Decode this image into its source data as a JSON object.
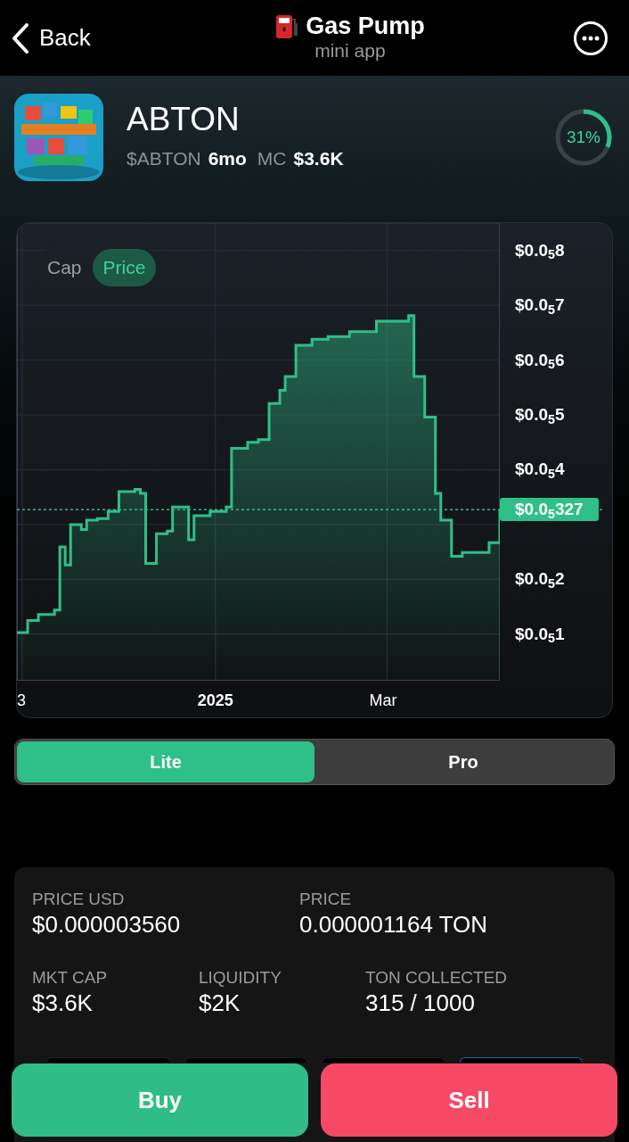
{
  "header": {
    "back": "Back",
    "title": "Gas Pump",
    "subtitle": "mini app"
  },
  "token": {
    "name": "ABTON",
    "ticker": "$ABTON",
    "age": "6mo",
    "mc_label": "MC",
    "mc_value": "$3.6K",
    "progress": {
      "level": 0.31,
      "label": "31%"
    }
  },
  "chart_toggle": [
    {
      "label": "Cap",
      "selected": false
    },
    {
      "label": "Price",
      "selected": true
    }
  ],
  "chart": {
    "current_price": "$0.0$_{5}$327",
    "y_labels": [
      "$0.0$_{5}$8",
      "$0.0$_{5}$7",
      "$0.0$_{5}$6",
      "$0.0$_{5}$5",
      "$0.0$_{5}$4",
      "$0.0$_{5}$2",
      "$0.0$_{5}$1"
    ],
    "x_labels": [
      "3",
      "2025",
      "Mar"
    ]
  },
  "mode_tabs": [
    {
      "label": "Lite",
      "selected": true
    },
    {
      "label": "Pro",
      "selected": false
    }
  ],
  "stats": [
    {
      "label": "PRICE USD",
      "value": "$0.000003560"
    },
    {
      "label": "PRICE",
      "value": "0.000001164 TON"
    },
    {
      "label": "MKT CAP",
      "value": "$3.6K"
    },
    {
      "label": "LIQUIDITY",
      "value": "$2K"
    },
    {
      "label": "TON COLLECTED",
      "value": "315 / 1000"
    }
  ],
  "chips": [
    {
      "selected": false
    },
    {
      "selected": false
    },
    {
      "selected": false
    },
    {
      "selected": true
    }
  ],
  "actions": [
    {
      "kind": "buy",
      "label": "Buy"
    },
    {
      "kind": "sell",
      "label": "Sell"
    }
  ]
}
